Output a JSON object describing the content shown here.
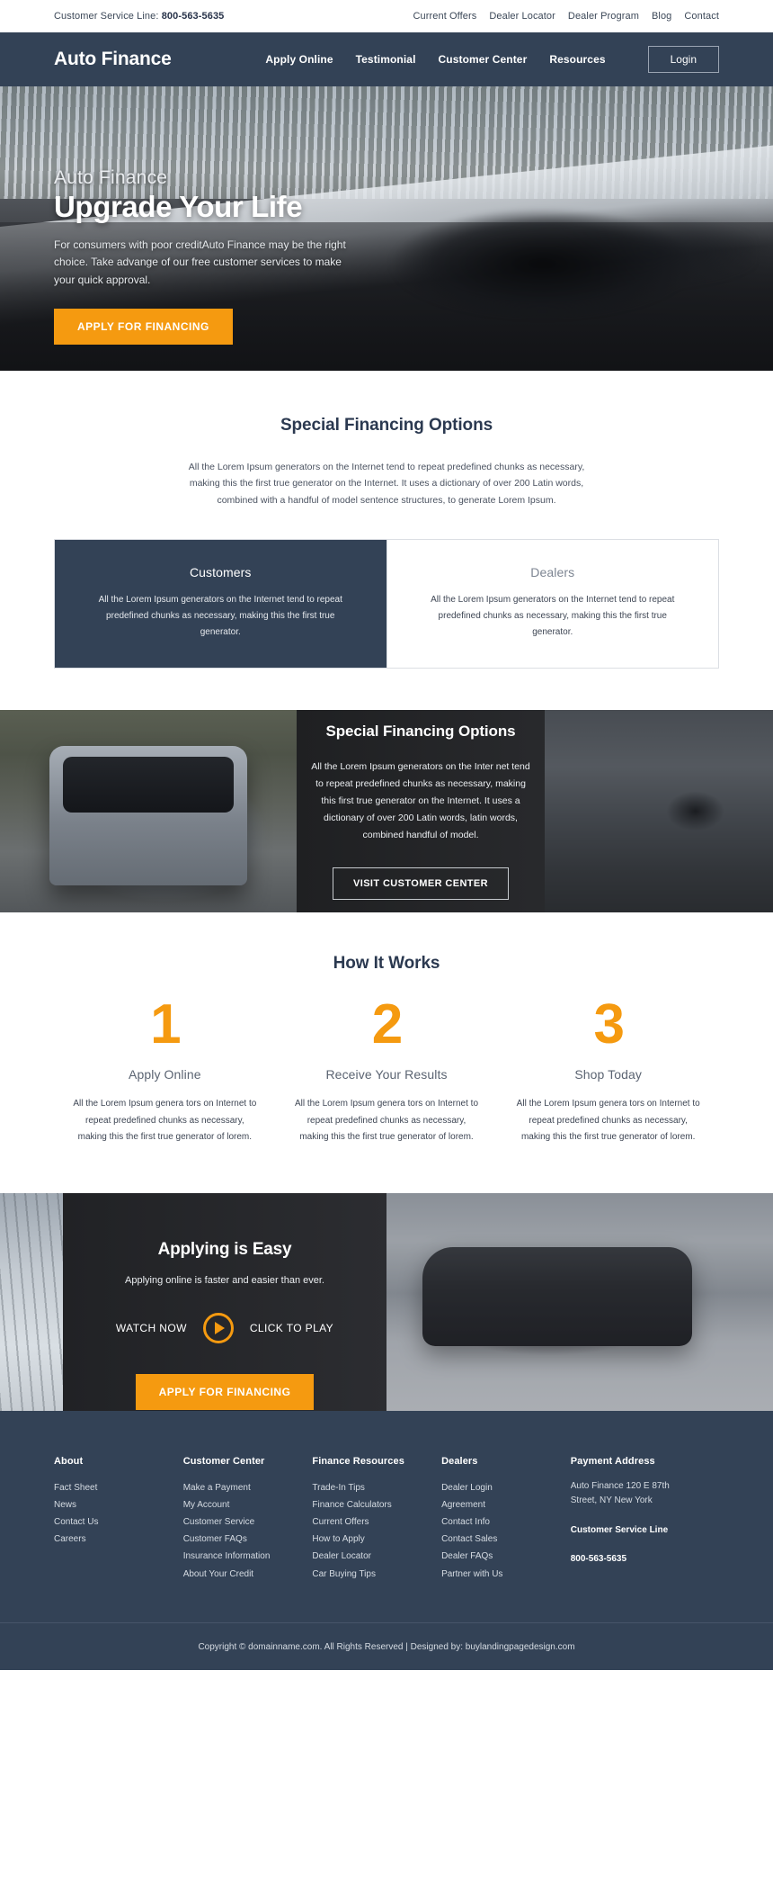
{
  "topbar": {
    "service_label": "Customer Service Line: ",
    "service_phone": "800-563-5635",
    "links": [
      "Current Offers",
      "Dealer Locator",
      "Dealer Program",
      "Blog",
      "Contact"
    ]
  },
  "header": {
    "brand": "Auto Finance",
    "nav": [
      "Apply Online",
      "Testimonial",
      "Customer Center",
      "Resources"
    ],
    "login_label": "Login"
  },
  "hero": {
    "eyebrow": "Auto Finance",
    "title": "Upgrade Your Life",
    "subtitle": "For consumers with poor creditAuto Finance may be the right choice. Take advange of our free customer services to make your quick approval.",
    "cta_label": "APPLY FOR FINANCING"
  },
  "financing": {
    "title": "Special Financing Options",
    "lead": "All the Lorem Ipsum generators on the Internet tend to repeat predefined chunks as necessary, making this the first true generator on the Internet. It uses a dictionary of over 200 Latin words, combined with a handful of model sentence structures, to generate Lorem Ipsum.",
    "cards": [
      {
        "title": "Customers",
        "text": "All the Lorem Ipsum generators on the Internet tend to repeat predefined chunks as necessary, making this the first true generator."
      },
      {
        "title": "Dealers",
        "text": "All the Lorem Ipsum generators on the Internet tend to repeat predefined chunks as necessary, making this the first true generator."
      }
    ]
  },
  "photo_split": {
    "title": "Special Financing Options",
    "text": "All the Lorem Ipsum generators on the Inter net tend to repeat predefined chunks as necessary, making this first true generator on the Internet. It uses a dictionary of over 200 Latin words, latin words, combined handful of model.",
    "cta_label": "VISIT CUSTOMER CENTER"
  },
  "how_it_works": {
    "title": "How It Works",
    "steps": [
      {
        "number": "1",
        "label": "Apply Online",
        "text": "All the Lorem Ipsum genera tors on Internet to repeat predefined chunks as necessary, making this the first true generator of lorem."
      },
      {
        "number": "2",
        "label": "Receive Your Results",
        "text": "All the Lorem Ipsum genera tors on Internet to repeat predefined chunks as necessary, making this the first true generator of lorem."
      },
      {
        "number": "3",
        "label": "Shop Today",
        "text": "All the Lorem Ipsum genera tors on Internet to repeat predefined chunks as necessary, making this the first true generator of lorem."
      }
    ]
  },
  "applying": {
    "title": "Applying is Easy",
    "subtitle": "Applying online is faster and easier than ever.",
    "watch_label": "WATCH NOW",
    "click_label": "CLICK TO PLAY",
    "cta_label": "APPLY FOR FINANCING"
  },
  "footer": {
    "columns": [
      {
        "heading": "About",
        "links": [
          "Fact Sheet",
          "News",
          "Contact Us",
          "Careers"
        ]
      },
      {
        "heading": "Customer Center",
        "links": [
          "Make a Payment",
          "My Account",
          "Customer Service",
          "Customer FAQs",
          "Insurance Information",
          "About Your Credit"
        ]
      },
      {
        "heading": "Finance Resources",
        "links": [
          "Trade-In Tips",
          "Finance Calculators",
          "Current Offers",
          "How to Apply",
          "Dealer Locator",
          "Car Buying Tips"
        ]
      },
      {
        "heading": "Dealers",
        "links": [
          "Dealer Login",
          "Agreement",
          "Contact Info",
          "Contact Sales",
          "Dealer FAQs",
          "Partner with Us"
        ]
      }
    ],
    "payment": {
      "heading": "Payment Address",
      "address_line1": "Auto Finance 120 E 87th",
      "address_line2": "Street, NY New York",
      "service_heading": "Customer Service Line",
      "service_phone": "800-563-5635"
    },
    "copyright": "Copyright © domainname.com. All Rights Reserved | Designed by: buylandingpagedesign.com"
  },
  "colors": {
    "navy": "#334256",
    "orange": "#f59a10",
    "body_text": "#3e4654"
  }
}
